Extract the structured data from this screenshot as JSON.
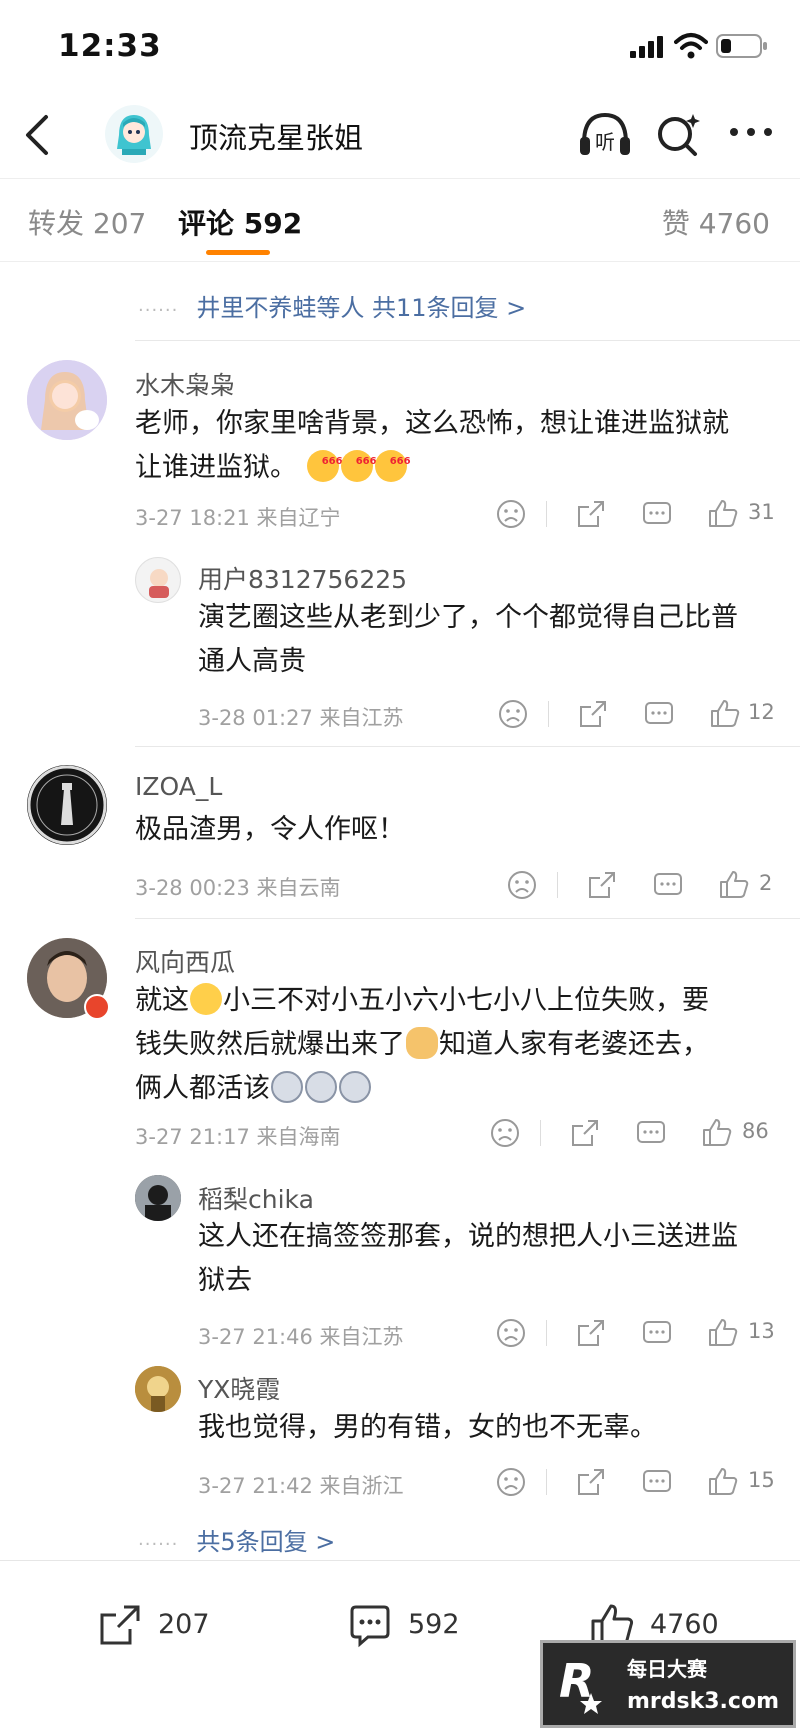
{
  "status_bar": {
    "time": "12:33"
  },
  "nav": {
    "title": "顶流克星张姐"
  },
  "tabs": {
    "repost": "转发 207",
    "comment": "评论 592",
    "like": "赞 4760"
  },
  "top_replies_line": "井里不养蛙等人  共11条回复 >",
  "comments": [
    {
      "user": "水木枭枭",
      "text_a": "老师，你家里啥背景，这么恐怖，想让谁进监狱就",
      "text_b": "让谁进监狱。",
      "time": "3-27 18:21 来自辽宁",
      "likes": "31",
      "replies": [
        {
          "user": "用户8312756225",
          "text_a": "演艺圈这些从老到少了，个个都觉得自己比普",
          "text_b": "通人高贵",
          "time": "3-28 01:27 来自江苏",
          "likes": "12"
        }
      ]
    },
    {
      "user": "IZOA_L",
      "text_a": "极品渣男，令人作呕！",
      "time": "3-28 00:23 来自云南",
      "likes": "2"
    },
    {
      "user": "风向西瓜",
      "text_a1": "就这",
      "text_a2": "小三不对小五小六小七小八上位失败，要",
      "text_b1": "钱失败然后就爆出来了",
      "text_b2": "知道人家有老婆还去，",
      "text_c": "俩人都活该",
      "time": "3-27 21:17 来自海南",
      "likes": "86",
      "replies": [
        {
          "user": "稻梨chika",
          "text_a": "这人还在搞签签那套，说的想把人小三送进监",
          "text_b": "狱去",
          "time": "3-27 21:46 来自江苏",
          "likes": "13"
        },
        {
          "user": "YX晓霞",
          "text_a": "我也觉得，男的有错，女的也不无辜。",
          "time": "3-27 21:42 来自浙江",
          "likes": "15"
        }
      ],
      "more_replies": "共5条回复 >"
    }
  ],
  "bottom_bar": {
    "repost": "207",
    "comment": "592",
    "like": "4760"
  },
  "watermark": {
    "line1": "每日大赛",
    "line2": "mrdsk3.com"
  },
  "icons": {
    "back": "chevron-left-icon",
    "listen": "headphones-icon",
    "search": "sparkle-search-icon",
    "more": "more-dots-icon",
    "dislike": "sad-face-icon",
    "share": "share-icon",
    "comment": "comment-icon",
    "like": "thumbs-up-icon"
  },
  "colors": {
    "accent": "#ff8200",
    "link": "#4b6ea2"
  }
}
